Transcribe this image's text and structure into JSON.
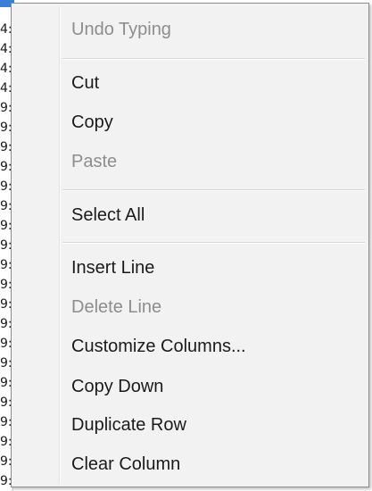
{
  "background": {
    "cells": [
      "4:",
      "4:",
      "4:",
      "4:",
      "9:",
      "9:",
      "9:",
      "9:",
      "9:",
      "9:",
      "9:",
      "9:",
      "9:",
      "9:",
      "9:",
      "9:",
      "9:",
      "9:",
      "9:",
      "9:",
      "9:",
      "9:",
      "9:",
      "9:"
    ]
  },
  "menu": {
    "undo": "Undo Typing",
    "cut": "Cut",
    "copy": "Copy",
    "paste": "Paste",
    "select_all": "Select All",
    "insert_line": "Insert Line",
    "delete_line": "Delete Line",
    "customize_columns": "Customize Columns...",
    "copy_down": "Copy Down",
    "duplicate_row": "Duplicate Row",
    "clear_column": "Clear Column"
  },
  "colors": {
    "menu_bg": "#f2f2f2",
    "enabled_text": "#1b1b1b",
    "disabled_text": "#8d8d8d",
    "selection": "#3d7fd6"
  }
}
